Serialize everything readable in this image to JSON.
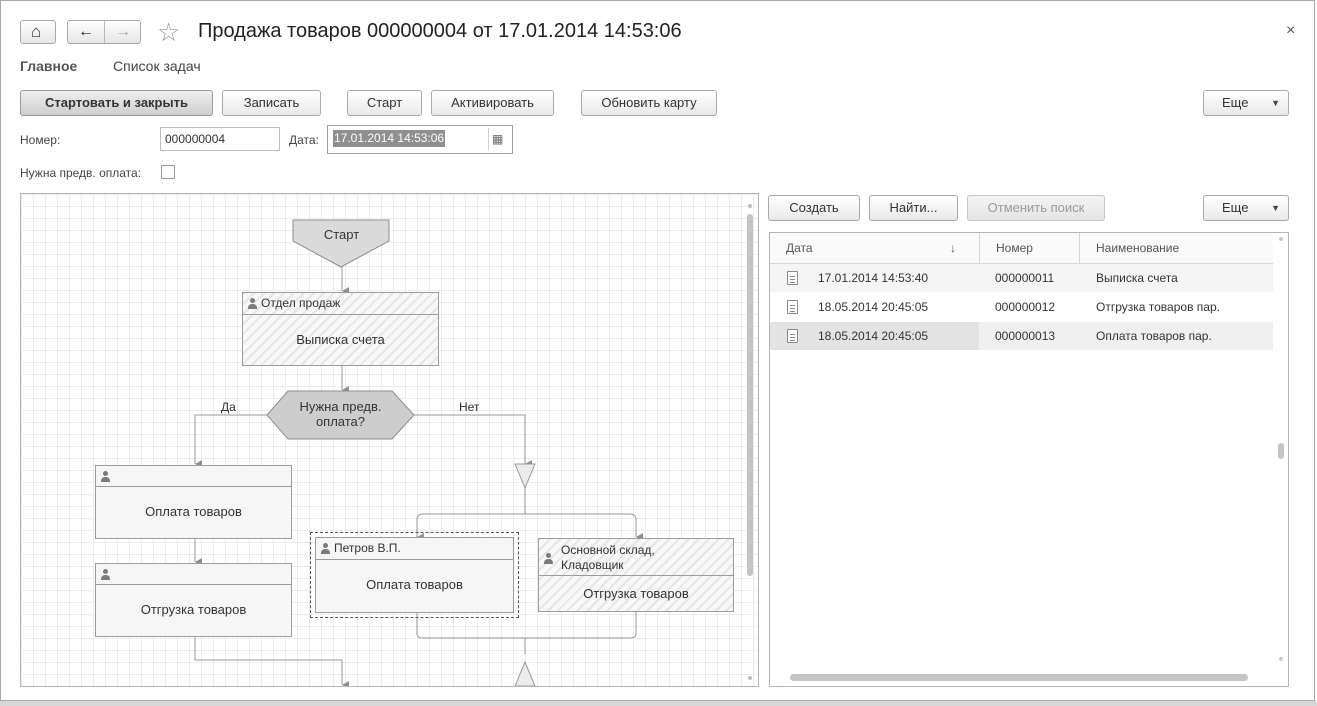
{
  "header": {
    "title": "Продажа товаров 000000004 от 17.01.2014 14:53:06",
    "close_glyph": "×",
    "home_glyph": "⌂",
    "back_glyph": "←",
    "forward_glyph": "→",
    "favorite_glyph": "☆"
  },
  "tabs": [
    {
      "label": "Главное"
    },
    {
      "label": "Список задач"
    }
  ],
  "toolbar": {
    "start_close": "Стартовать и закрыть",
    "save": "Записать",
    "start": "Старт",
    "activate": "Активировать",
    "refresh_map": "Обновить карту",
    "more": "Еще",
    "more_arrow": "▼"
  },
  "form": {
    "number_label": "Номер:",
    "number_value": "000000004",
    "date_label": "Дата:",
    "date_value": "17.01.2014 14:53:06",
    "calendar_glyph": "▦",
    "prepay_label": "Нужна предв. оплата:"
  },
  "map": {
    "start": "Старт",
    "sales_dept_head": "Отдел продаж",
    "invoice": "Выписка счета",
    "condition_line1": "Нужна предв.",
    "condition_line2": "оплата?",
    "yes": "Да",
    "no": "Нет",
    "payment_left": "Оплата товаров",
    "shipment_left": "Отгрузка товаров",
    "petrov_head": "Петров В.П.",
    "payment_mid": "Оплата товаров",
    "warehouse_head_line1": "Основной склад,",
    "warehouse_head_line2": "Кладовщик",
    "shipment_right": "Отгрузка товаров"
  },
  "tasks_toolbar": {
    "create": "Создать",
    "find": "Найти...",
    "cancel_search": "Отменить поиск",
    "more": "Еще",
    "more_arrow": "▼"
  },
  "tasks_table": {
    "columns": {
      "date": "Дата",
      "sort_glyph": "↓",
      "number": "Номер",
      "name": "Наименование"
    },
    "rows": [
      {
        "date": "17.01.2014 14:53:40",
        "number": "000000011",
        "name": "Выписка счета"
      },
      {
        "date": "18.05.2014 20:45:05",
        "number": "000000012",
        "name": "Отгрузка товаров пар."
      },
      {
        "date": "18.05.2014 20:45:05",
        "number": "000000013",
        "name": "Оплата товаров пар."
      }
    ]
  }
}
